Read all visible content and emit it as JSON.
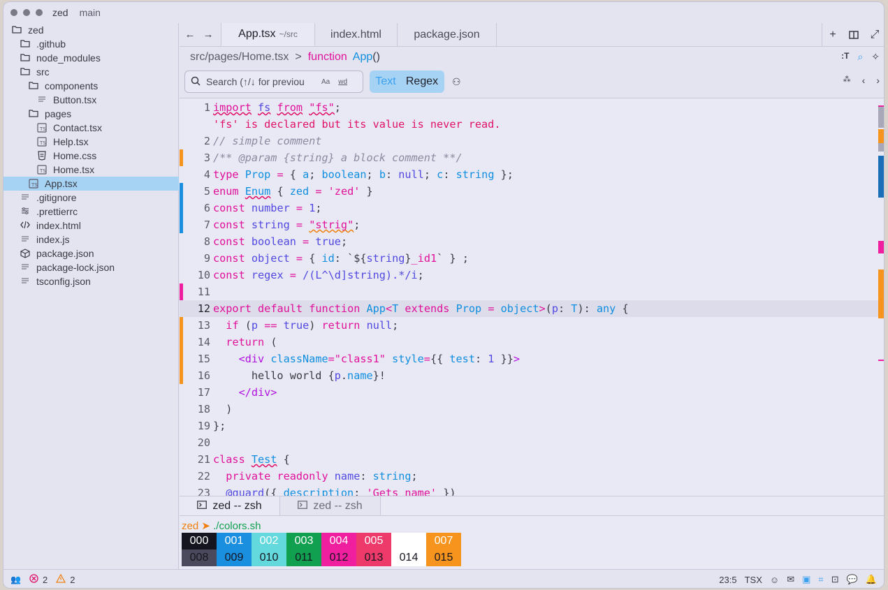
{
  "window": {
    "project": "zed",
    "branch": "main"
  },
  "sidebar": {
    "items": [
      {
        "label": "zed",
        "icon": "folder-open-icon",
        "depth": 0
      },
      {
        "label": ".github",
        "icon": "folder-icon",
        "depth": 1
      },
      {
        "label": "node_modules",
        "icon": "folder-icon",
        "depth": 1
      },
      {
        "label": "src",
        "icon": "folder-open-icon",
        "depth": 1
      },
      {
        "label": "components",
        "icon": "folder-open-icon",
        "depth": 2
      },
      {
        "label": "Button.tsx",
        "icon": "file-icon",
        "depth": 3
      },
      {
        "label": "pages",
        "icon": "folder-open-icon",
        "depth": 2
      },
      {
        "label": "Contact.tsx",
        "icon": "tsx-file-icon",
        "depth": 3
      },
      {
        "label": "Help.tsx",
        "icon": "tsx-file-icon",
        "depth": 3
      },
      {
        "label": "Home.css",
        "icon": "css-file-icon",
        "depth": 3
      },
      {
        "label": "Home.tsx",
        "icon": "tsx-file-icon",
        "depth": 3
      },
      {
        "label": "App.tsx",
        "icon": "tsx-file-icon",
        "depth": 2,
        "selected": true
      },
      {
        "label": ".gitignore",
        "icon": "file-icon",
        "depth": 1
      },
      {
        "label": ".prettierrc",
        "icon": "settings-file-icon",
        "depth": 1
      },
      {
        "label": "index.html",
        "icon": "code-file-icon",
        "depth": 1
      },
      {
        "label": "index.js",
        "icon": "file-icon",
        "depth": 1
      },
      {
        "label": "package.json",
        "icon": "package-icon",
        "depth": 1
      },
      {
        "label": "package-lock.json",
        "icon": "file-icon",
        "depth": 1
      },
      {
        "label": "tsconfig.json",
        "icon": "file-icon",
        "depth": 1
      }
    ]
  },
  "tabs": [
    {
      "label": "App.tsx",
      "sub": "~/src",
      "active": true
    },
    {
      "label": "index.html",
      "sub": ""
    },
    {
      "label": "package.json",
      "sub": ""
    }
  ],
  "breadcrumb": {
    "path": "src/pages/Home.tsx",
    "sep": ">",
    "keyword": "function",
    "name": "App",
    "parens": "()"
  },
  "search": {
    "placeholder": "Search (↑/↓ for previou",
    "case_opt": "Aa",
    "word_opt": "wd",
    "mode_text": "Text",
    "mode_regex": "Regex"
  },
  "code": {
    "lines": [
      {
        "n": "1",
        "html": "<span class='k sq'>import</span> <span class='t sq'>fs</span> <span class='k sq'>from</span> <span class='s sq'>\"fs\"</span>;"
      },
      {
        "n": "",
        "html": "<span class='err'>'fs' is declared but its value is never read.</span>"
      },
      {
        "n": "2",
        "html": "<span class='c'>// simple comment</span>"
      },
      {
        "n": "3",
        "html": "<span class='c'>/** @param {string} a block comment **/</span>",
        "mark": "#f7941d"
      },
      {
        "n": "4",
        "html": "<span class='k'>type</span> <span class='f'>Prop</span> <span class='k'>=</span> { <span class='prop'>a</span>; <span class='f'>boolean</span>; <span class='prop'>b</span>: <span class='t'>null</span>; <span class='prop'>c</span>: <span class='f'>string</span> };"
      },
      {
        "n": "5",
        "html": "<span class='k'>enum</span> <span class='f sq'>Enum</span> { <span class='prop'>zed</span> <span class='k'>=</span> <span class='s'>'zed'</span> }",
        "mark": "#1a8fe0"
      },
      {
        "n": "6",
        "html": "<span class='k'>const</span> <span class='t'>number</span> <span class='k'>=</span> <span class='n'>1</span>;",
        "mark": "#1a8fe0"
      },
      {
        "n": "7",
        "html": "<span class='k'>const</span> <span class='t'>string</span> <span class='k'>=</span> <span class='s sqw'>\"strig\"</span>;",
        "mark": "#1a8fe0"
      },
      {
        "n": "8",
        "html": "<span class='k'>const</span> <span class='t'>boolean</span> <span class='k'>=</span> <span class='t'>true</span>;"
      },
      {
        "n": "9",
        "html": "<span class='k'>const</span> <span class='t'>object</span> <span class='k'>=</span> { <span class='prop'>id</span>: `${<span class='t'>string</span>}<span class='s'>_id1</span>` } ;"
      },
      {
        "n": "10",
        "html": "<span class='k'>const</span> <span class='t'>regex</span> <span class='k'>=</span> <span class='t'>/(L^\\d]string).*/i</span>;"
      },
      {
        "n": "11",
        "html": "",
        "mark": "#f01fa0"
      },
      {
        "n": "12",
        "html": "<span class='k'>export</span> <span class='k'>default</span> <span class='k'>function</span> <span class='f'>App</span><span class='k'>&lt;</span><span class='f'>T</span> <span class='k'>extends</span> <span class='f'>Prop</span> <span class='k'>=</span> <span class='f'>object</span><span class='k'>&gt;</span>(<span class='t'>p</span>: <span class='f'>T</span>): <span class='f'>any</span> {",
        "current": true
      },
      {
        "n": "13",
        "html": "  <span class='k'>if</span> (<span class='t'>p</span> <span class='k'>==</span> <span class='t'>true</span>) <span class='k'>return</span> <span class='t'>null</span>;",
        "mark": "#f7941d"
      },
      {
        "n": "14",
        "html": "  <span class='k'>return</span> (",
        "mark": "#f7941d"
      },
      {
        "n": "15",
        "html": "    <span class='tag'>&lt;div</span> <span class='prop'>className</span><span class='k'>=</span><span class='s'>\"class1\"</span> <span class='prop'>style</span><span class='k'>=</span>{{ <span class='prop'>test</span>: <span class='n'>1</span> }}<span class='tag'>&gt;</span>",
        "mark": "#f7941d"
      },
      {
        "n": "16",
        "html": "      hello world {<span class='t'>p</span>.<span class='prop'>name</span>}!",
        "mark": "#f7941d"
      },
      {
        "n": "17",
        "html": "    <span class='tag'>&lt;/div&gt;</span>"
      },
      {
        "n": "18",
        "html": "  )"
      },
      {
        "n": "19",
        "html": "};"
      },
      {
        "n": "20",
        "html": ""
      },
      {
        "n": "21",
        "html": "<span class='k'>class</span> <span class='f sq'>Test</span> {"
      },
      {
        "n": "22",
        "html": "  <span class='k'>private</span> <span class='k'>readonly</span> <span class='t'>name</span>: <span class='f'>string</span>;"
      },
      {
        "n": "23",
        "html": "  <span class='t'>@guard</span>({ <span class='prop'>description</span>: <span class='s'>'Gets name'</span> })"
      }
    ]
  },
  "scrollbar_marks": [
    {
      "color": "#f01fa0"
    },
    {
      "color": "#a8a8b8"
    },
    {
      "color": "#f7941d"
    },
    {
      "color": "#a8a8b8"
    },
    {
      "color": "#1a6fb8"
    },
    {
      "color": "#f01fa0"
    },
    {
      "color": "#f7941d"
    },
    {
      "color": "#f01fa0"
    }
  ],
  "terminal": {
    "tabs": [
      "zed -- zsh",
      "zed -- zsh"
    ],
    "prompt_dir": "zed",
    "prompt_arrow": "➤",
    "prompt_cmd": "./colors.sh",
    "colors": [
      {
        "label": "000",
        "bg": "#15151f",
        "fg": "#ffffff"
      },
      {
        "label": "001",
        "bg": "#1a8fe0",
        "fg": "#ffffff"
      },
      {
        "label": "002",
        "bg": "#63d9dd",
        "fg": "#ffffff"
      },
      {
        "label": "003",
        "bg": "#10a050",
        "fg": "#ffffff"
      },
      {
        "label": "004",
        "bg": "#f01fa0",
        "fg": "#ffffff"
      },
      {
        "label": "005",
        "bg": "#ee3a6a",
        "fg": "#ffffff"
      },
      {
        "label": "",
        "bg": "#ffffff",
        "fg": "#ffffff"
      },
      {
        "label": "007",
        "bg": "#f7941d",
        "fg": "#ffffff"
      },
      {
        "label": "008",
        "bg": "#4a4a5c",
        "fg": "#15151f"
      },
      {
        "label": "009",
        "bg": "#1a8fe0",
        "fg": "#15151f"
      },
      {
        "label": "010",
        "bg": "#63d9dd",
        "fg": "#15151f"
      },
      {
        "label": "011",
        "bg": "#10a050",
        "fg": "#15151f"
      },
      {
        "label": "012",
        "bg": "#f01fa0",
        "fg": "#15151f"
      },
      {
        "label": "013",
        "bg": "#ee3a6a",
        "fg": "#15151f"
      },
      {
        "label": "014",
        "bg": "#ffffff",
        "fg": "#15151f"
      },
      {
        "label": "015",
        "bg": "#f7941d",
        "fg": "#15151f"
      }
    ]
  },
  "status": {
    "errors": "2",
    "warnings": "2",
    "cursor": "23:5",
    "language": "TSX"
  }
}
